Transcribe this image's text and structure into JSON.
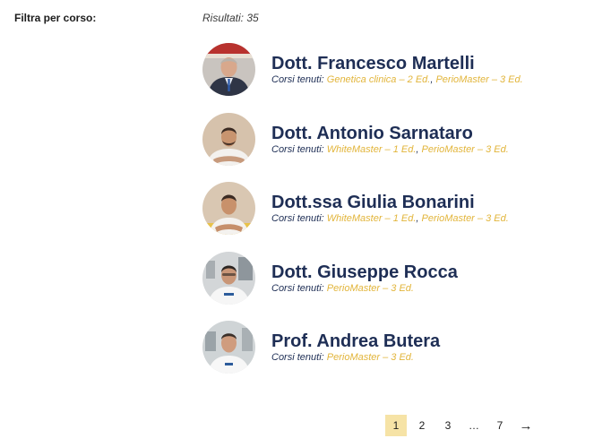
{
  "filter": {
    "label": "Filtra per corso:"
  },
  "results": {
    "label": "Risultati: 35"
  },
  "courses_prefix": "Corsi tenuti:",
  "doctors": [
    {
      "name": "Dott. Francesco Martelli",
      "courses": [
        "Genetica clinica – 2 Ed.",
        "PerioMaster – 3 Ed."
      ]
    },
    {
      "name": "Dott. Antonio Sarnataro",
      "courses": [
        "WhiteMaster – 1 Ed.",
        "PerioMaster – 3 Ed."
      ]
    },
    {
      "name": "Dott.ssa Giulia Bonarini",
      "courses": [
        "WhiteMaster – 1 Ed.",
        "PerioMaster – 3 Ed."
      ]
    },
    {
      "name": "Dott. Giuseppe Rocca",
      "courses": [
        "PerioMaster – 3 Ed."
      ]
    },
    {
      "name": "Prof. Andrea Butera",
      "courses": [
        "PerioMaster – 3 Ed."
      ]
    }
  ],
  "pagination": {
    "pages": [
      "1",
      "2",
      "3",
      "…",
      "7"
    ],
    "active": "1",
    "next_icon": "→"
  },
  "colors": {
    "name": "#1e2e55",
    "course_link": "#e2b53b",
    "active_page_bg": "#f6e3a6"
  }
}
